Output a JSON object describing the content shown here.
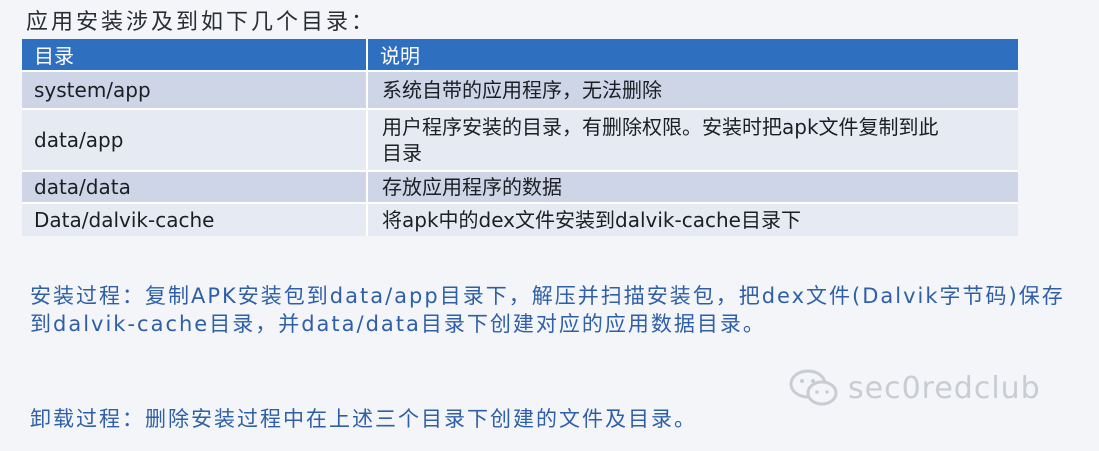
{
  "intro": "应用安装涉及到如下几个目录：",
  "table": {
    "headers": [
      "目录",
      "说明"
    ],
    "rows": [
      {
        "dir": "system/app",
        "desc": "系统自带的应用程序，无法删除"
      },
      {
        "dir": "data/app",
        "desc": "用户程序安装的目录，有删除权限。安装时把apk文件复制到此目录"
      },
      {
        "dir": "data/data",
        "desc": "存放应用程序的数据"
      },
      {
        "dir": "Data/dalvik-cache",
        "desc": "将apk中的dex文件安装到dalvik-cache目录下"
      }
    ]
  },
  "install_process": "安装过程：复制APK安装包到data/app目录下，解压并扫描安装包，把dex文件(Dalvik字节码)保存到dalvik-cache目录，并data/data目录下创建对应的应用数据目录。",
  "uninstall_process": "卸载过程：删除安装过程中在上述三个目录下创建的文件及目录。",
  "watermark": {
    "icon": "wechat-icon",
    "text": "sec0redclub"
  }
}
